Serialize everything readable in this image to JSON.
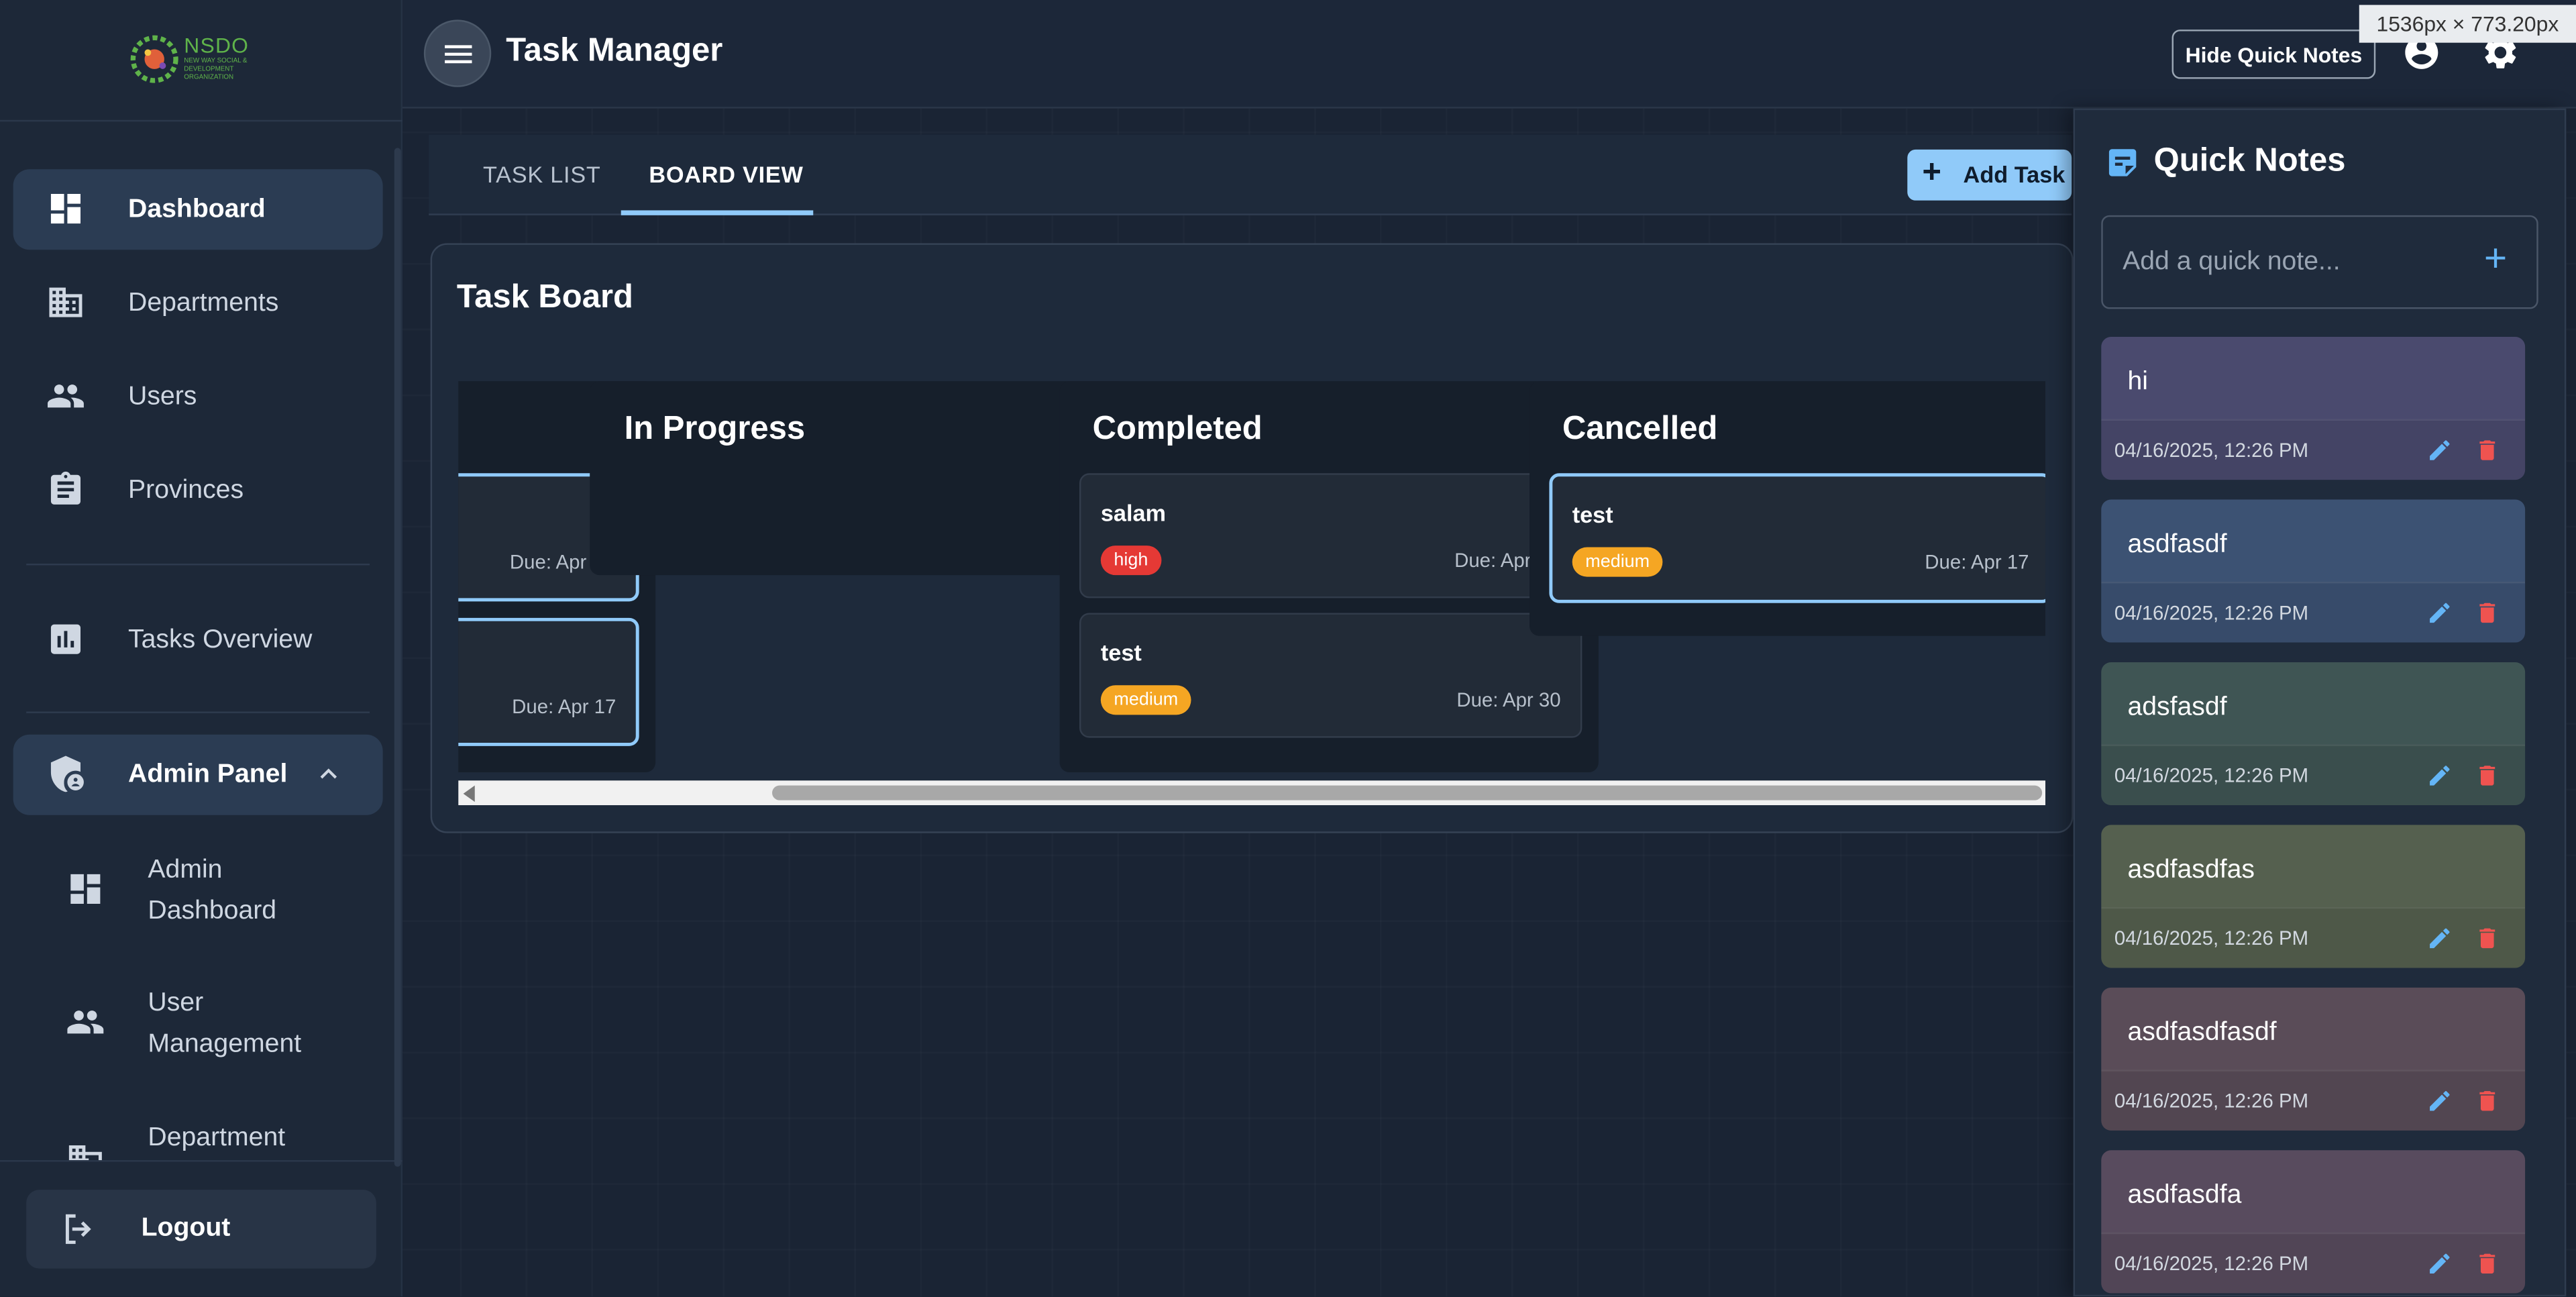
{
  "brand": {
    "logo_text": "NSDO",
    "logo_sub": "NEW WAY SOCIAL & DEVELOPMENT ORGANIZATION"
  },
  "sidebar": {
    "items": [
      {
        "label": "Dashboard",
        "icon": "dashboard-icon"
      },
      {
        "label": "Departments",
        "icon": "building-icon"
      },
      {
        "label": "Users",
        "icon": "users-icon"
      },
      {
        "label": "Provinces",
        "icon": "clipboard-icon"
      },
      {
        "label": "Tasks Overview",
        "icon": "bar-chart-icon"
      },
      {
        "label": "Admin Panel",
        "icon": "admin-shield-icon"
      }
    ],
    "admin_sub": [
      {
        "label": "Admin Dashboard",
        "icon": "dashboard-icon"
      },
      {
        "label": "User Management",
        "icon": "users-icon"
      },
      {
        "label": "Department",
        "icon": "building-icon"
      }
    ],
    "logout": "Logout"
  },
  "header": {
    "title": "Task Manager",
    "hide_notes": "Hide Quick Notes",
    "dim_readout": "1536px × 773.20px"
  },
  "tabs": [
    {
      "label": "TASK LIST"
    },
    {
      "label": "BOARD VIEW"
    }
  ],
  "add_task": "Add Task",
  "board": {
    "title": "Task Board",
    "columns": [
      {
        "title": "",
        "cards": [
          {
            "title": "",
            "priority": "",
            "due": "Due: Apr"
          },
          {
            "title": "",
            "priority": "",
            "due": "Due: Apr 17"
          }
        ]
      },
      {
        "title": "In Progress",
        "cards": []
      },
      {
        "title": "Completed",
        "cards": [
          {
            "title": "salam",
            "priority": "high",
            "due": "Due: Apr"
          },
          {
            "title": "test",
            "priority": "medium",
            "due": "Due: Apr 30"
          }
        ]
      },
      {
        "title": "Cancelled",
        "cards": [
          {
            "title": "test",
            "priority": "medium",
            "due": "Due: Apr 17"
          }
        ]
      }
    ]
  },
  "quick_notes": {
    "title": "Quick Notes",
    "placeholder": "Add a quick note...",
    "notes": [
      {
        "text": "hi",
        "date": "04/16/2025, 12:26 PM",
        "color": "#4a4a6e"
      },
      {
        "text": "asdfasdf",
        "date": "04/16/2025, 12:26 PM",
        "color": "#3c5273"
      },
      {
        "text": "adsfasdf",
        "date": "04/16/2025, 12:26 PM",
        "color": "#3f5554"
      },
      {
        "text": "asdfasdfas",
        "date": "04/16/2025, 12:26 PM",
        "color": "#55604f"
      },
      {
        "text": "asdfasdfasdf",
        "date": "04/16/2025, 12:26 PM",
        "color": "#5a4c58"
      },
      {
        "text": "asdfasdfa",
        "date": "04/16/2025, 12:26 PM",
        "color": "#584b5e"
      }
    ]
  },
  "colors": {
    "accent": "#90caf9",
    "high": "#e53935",
    "medium": "#f5a623",
    "delete": "#ef5350"
  }
}
